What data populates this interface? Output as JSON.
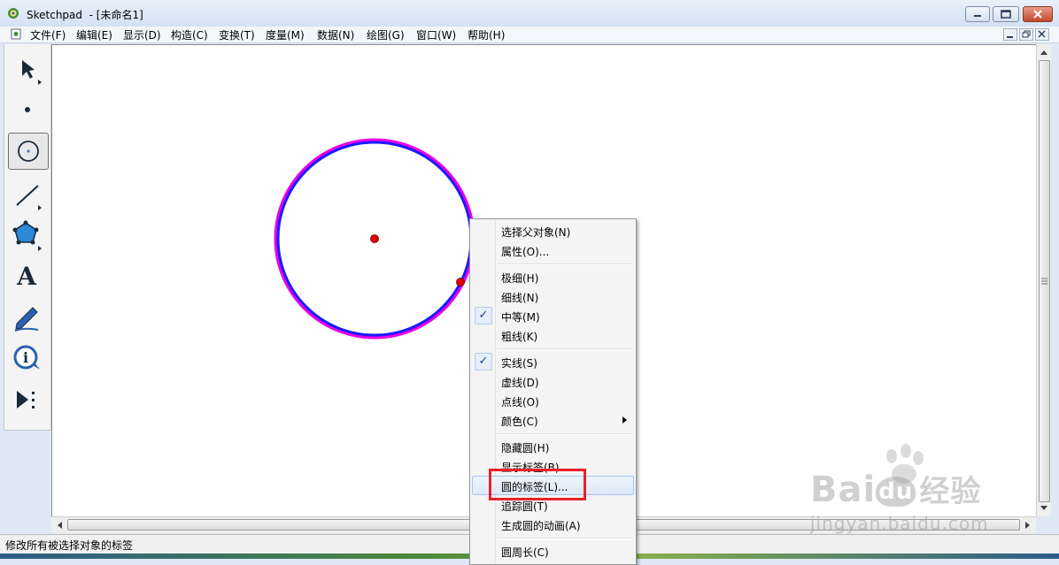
{
  "window": {
    "title": "Sketchpad  - [未命名1]"
  },
  "menubar": {
    "items": [
      "文件(F)",
      "编辑(E)",
      "显示(D)",
      "构造(C)",
      "变换(T)",
      "度量(M)",
      "数据(N)",
      "绘图(G)",
      "窗口(W)",
      "帮助(H)"
    ]
  },
  "toolbox": {
    "tools": [
      {
        "name": "arrow-select-tool",
        "icon": "arrow-icon"
      },
      {
        "name": "point-tool",
        "icon": "point-icon"
      },
      {
        "name": "compass-tool",
        "icon": "circle-icon",
        "selected": true
      },
      {
        "name": "straightedge-tool",
        "icon": "line-icon"
      },
      {
        "name": "polygon-tool",
        "icon": "polygon-icon"
      },
      {
        "name": "text-tool",
        "icon": "text-a-icon",
        "glyph": "A"
      },
      {
        "name": "marker-tool",
        "icon": "marker-pen-icon"
      },
      {
        "name": "information-tool",
        "icon": "info-icon",
        "glyph": "i"
      },
      {
        "name": "custom-tool",
        "icon": "play-custom-icon"
      }
    ]
  },
  "canvas": {
    "circle_color": "#1a1aff",
    "selection_color": "#e600e6",
    "point_color": "#e00000"
  },
  "context_menu": {
    "items": [
      {
        "label": "选择父对象(N)"
      },
      {
        "label": "属性(O)..."
      },
      {
        "label": "极细(H)"
      },
      {
        "label": "细线(N)"
      },
      {
        "label": "中等(M)",
        "checked": true
      },
      {
        "label": "粗线(K)"
      },
      {
        "label": "实线(S)",
        "checked": true
      },
      {
        "label": "虚线(D)"
      },
      {
        "label": "点线(O)"
      },
      {
        "label": "颜色(C)",
        "submenu": true
      },
      {
        "label": "隐藏圆(H)"
      },
      {
        "label": "显示标签(B)"
      },
      {
        "label": "圆的标签(L)...",
        "highlighted": true
      },
      {
        "label": "追踪圆(T)"
      },
      {
        "label": "生成圆的动画(A)"
      },
      {
        "label": "圆周长(C)"
      }
    ]
  },
  "status": {
    "text": "修改所有被选择对象的标签"
  },
  "watermark": {
    "brand": "Bai",
    "brand_du": "du",
    "brand_cn": "经验",
    "url": "jingyan.baidu.com"
  },
  "colors": {
    "highlight_box": "#e8222a",
    "check_mark": "#1b3f8b"
  }
}
